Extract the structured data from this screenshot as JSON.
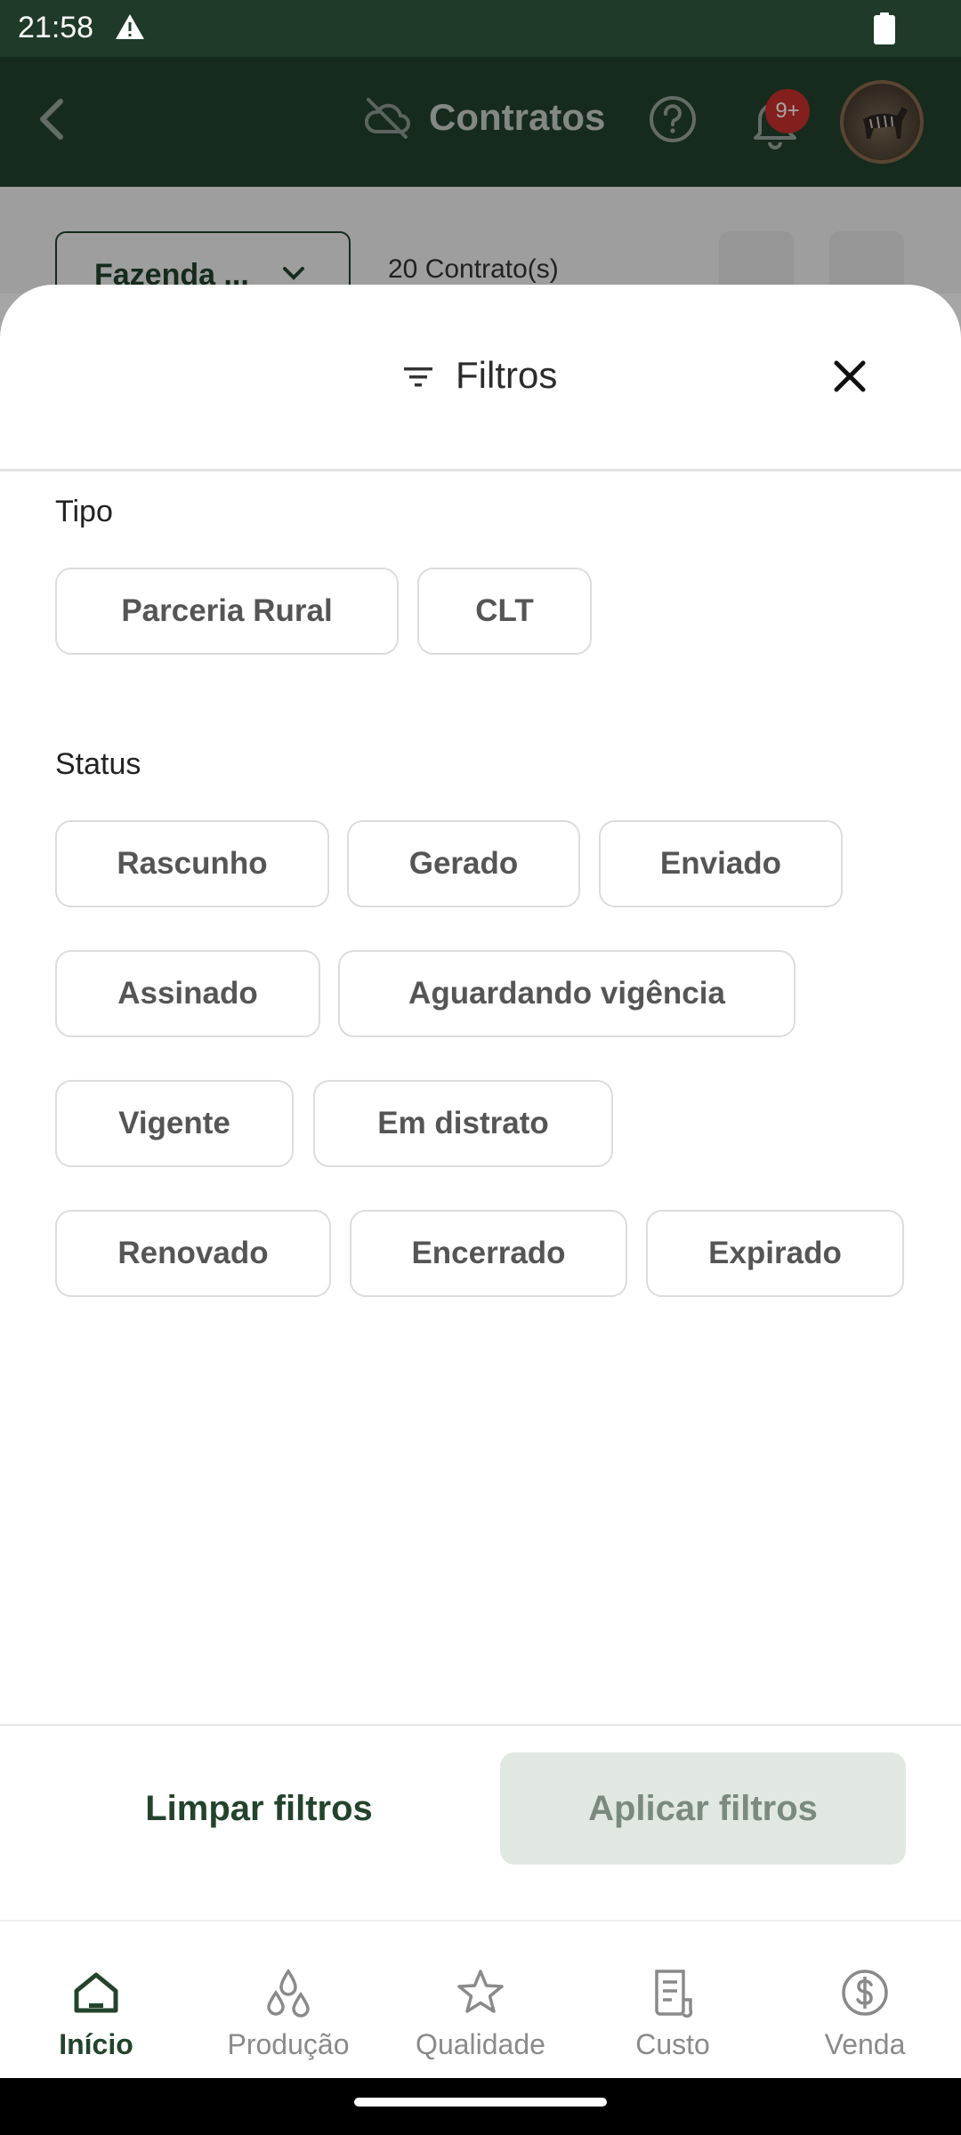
{
  "status_bar": {
    "time": "21:58"
  },
  "app_bar": {
    "title": "Contratos",
    "notifications_badge": "9+"
  },
  "list_header": {
    "farm_select": "Fazenda ...",
    "contracts_count": "20 Contrato(s)"
  },
  "sheet": {
    "title": "Filtros",
    "tipo": {
      "label": "Tipo",
      "options": [
        "Parceria Rural",
        "CLT"
      ]
    },
    "status": {
      "label": "Status",
      "options": [
        "Rascunho",
        "Gerado",
        "Enviado",
        "Assinado",
        "Aguardando vigência",
        "Vigente",
        "Em distrato",
        "Renovado",
        "Encerrado",
        "Expirado"
      ]
    },
    "clear_label": "Limpar filtros",
    "apply_label": "Aplicar filtros"
  },
  "bottom_nav": {
    "items": [
      {
        "label": "Início",
        "icon": "home-icon",
        "active": true
      },
      {
        "label": "Produção",
        "icon": "drops-icon",
        "active": false
      },
      {
        "label": "Qualidade",
        "icon": "star-icon",
        "active": false
      },
      {
        "label": "Custo",
        "icon": "receipt-icon",
        "active": false
      },
      {
        "label": "Venda",
        "icon": "dollar-circle-icon",
        "active": false
      }
    ]
  },
  "colors": {
    "primary": "#23432d",
    "apply_bg": "#e1e8e2",
    "badge": "#c9302c"
  }
}
